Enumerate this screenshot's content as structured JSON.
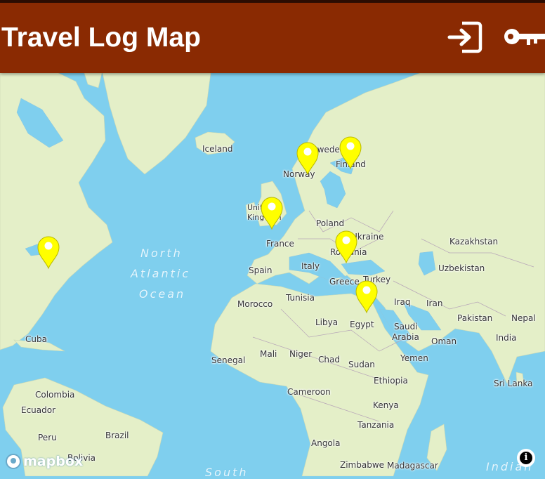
{
  "app": {
    "title": "Travel Log Map",
    "accent": "#8a2a02",
    "header_icons": [
      "sign-in-icon",
      "key-icon"
    ]
  },
  "map": {
    "provider_logo": "mapbox",
    "water_color": "#7fcfee",
    "land_color": "#e4efc8",
    "pin_color": "#ffff00",
    "countries": [
      "Iceland",
      "Sweden",
      "Finland",
      "Norway",
      "United Kingdom",
      "Poland",
      "Ukraine",
      "France",
      "Romania",
      "Kazakhstan",
      "Italy",
      "Spain",
      "Uzbekistan",
      "Greece",
      "Turkey",
      "Morocco",
      "Tunisia",
      "Iraq",
      "Iran",
      "Libya",
      "Egypt",
      "Saudi Arabia",
      "Pakistan",
      "Nepal",
      "India",
      "Oman",
      "Cuba",
      "Mali",
      "Niger",
      "Chad",
      "Sudan",
      "Yemen",
      "Senegal",
      "Ethiopia",
      "Sri Lanka",
      "Cameroon",
      "Colombia",
      "Kenya",
      "Ecuador",
      "Brazil",
      "Tanzania",
      "Peru",
      "Angola",
      "Bolivia",
      "Zimbabwe",
      "Madagascar"
    ],
    "label_text": {
      "iceland": "Iceland",
      "sweden": "Sweden",
      "finland": "Finland",
      "norway": "Norway",
      "uk": "United Kingdom",
      "poland": "Poland",
      "ukraine": "Ukraine",
      "france": "France",
      "romania": "Romania",
      "kazakhstan": "Kazakhstan",
      "italy": "Italy",
      "spain": "Spain",
      "uzbekistan": "Uzbekistan",
      "greece": "Greece",
      "turkey": "Turkey",
      "morocco": "Morocco",
      "tunisia": "Tunisia",
      "iraq": "Iraq",
      "iran": "Iran",
      "libya": "Libya",
      "egypt": "Egypt",
      "saudi_1": "Saudi",
      "saudi_2": "Arabia",
      "pakistan": "Pakistan",
      "nepal": "Nepal",
      "india": "India",
      "oman": "Oman",
      "cuba": "Cuba",
      "mali": "Mali",
      "niger": "Niger",
      "chad": "Chad",
      "sudan": "Sudan",
      "yemen": "Yemen",
      "senegal": "Senegal",
      "ethiopia": "Ethiopia",
      "srilanka": "Sri Lanka",
      "cameroon": "Cameroon",
      "colombia": "Colombia",
      "kenya": "Kenya",
      "ecuador": "Ecuador",
      "brazil": "Brazil",
      "tanzania": "Tanzania",
      "peru": "Peru",
      "angola": "Angola",
      "bolivia": "Bolivia",
      "zimbabwe": "Zimbabwe",
      "madagascar": "Madagascar",
      "ocean_1": "North",
      "ocean_2": "Atlantic",
      "ocean_3": "Ocean",
      "south": "South",
      "indian": "Indian"
    },
    "markers": [
      "Norway",
      "Finland",
      "United Kingdom",
      "Romania",
      "Egypt",
      "United States"
    ]
  }
}
